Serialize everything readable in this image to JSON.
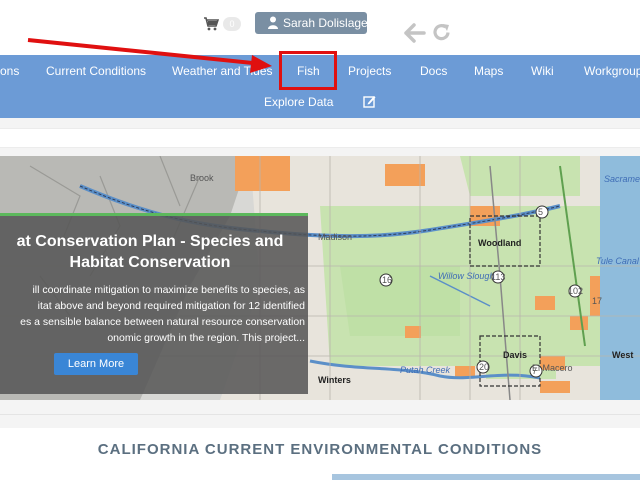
{
  "header": {
    "cart_count": "0",
    "user_name": "Sarah Dolislager",
    "icons": [
      "shopping-cart-icon",
      "user-icon",
      "back-arrow-icon",
      "reload-icon"
    ]
  },
  "nav": {
    "items": [
      {
        "label": "ons"
      },
      {
        "label": "Current Conditions"
      },
      {
        "label": "Weather and Tides"
      },
      {
        "label": "Fish"
      },
      {
        "label": "Projects"
      },
      {
        "label": "Docs"
      },
      {
        "label": "Maps"
      },
      {
        "label": "Wiki"
      },
      {
        "label": "Workgroup"
      }
    ],
    "row2": {
      "explore": "Explore Data"
    },
    "colors": {
      "nav_bg": "#6c9bd6",
      "highlight": "#e01010"
    }
  },
  "hero": {
    "title": "at Conservation Plan - Species and\nHabitat Conservation",
    "text": "ill coordinate mitigation to maximize benefits to species, as\nitat above and beyond required mitigation for 12 identified\nes a sensible balance between natural resource conservation\nonomic growth in the region. This project...",
    "button": "Learn More",
    "map_labels": {
      "brook": "Brook",
      "madison": "Madison",
      "woodland": "Woodland",
      "willow": "Willow Slough",
      "davis": "Davis",
      "west": "West",
      "winters": "Winters",
      "putah": "Putah Creek",
      "elmacero": "El Macero",
      "tulecanal": "Tule Canal",
      "sacramento": "Sacramento R",
      "r113": "113",
      "r16": "16",
      "r5": "5",
      "r102": "102",
      "r17": "17",
      "r7": "7",
      "r20": "20"
    }
  },
  "section": {
    "heading": "CALIFORNIA CURRENT ENVIRONMENTAL CONDITIONS"
  }
}
